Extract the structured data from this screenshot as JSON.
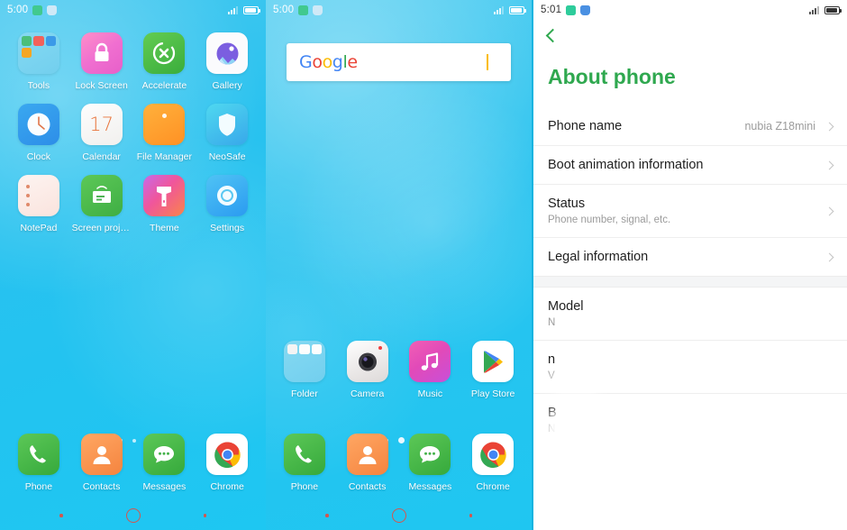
{
  "panel_home": {
    "statusbar": {
      "time": "5:00",
      "icons": [
        "gallery-sync-icon",
        "shield-icon"
      ],
      "signal": "signal-bars-icon",
      "battery": "battery-icon"
    },
    "apps": [
      {
        "label": "Tools",
        "icon": "tools-folder-icon"
      },
      {
        "label": "Lock Screen",
        "icon": "lock-icon"
      },
      {
        "label": "Accelerate",
        "icon": "accelerate-icon"
      },
      {
        "label": "Gallery",
        "icon": "gallery-icon"
      },
      {
        "label": "Clock",
        "icon": "clock-icon"
      },
      {
        "label": "Calendar",
        "icon": "calendar-icon",
        "day": "17"
      },
      {
        "label": "File Manager",
        "icon": "file-manager-icon"
      },
      {
        "label": "NeoSafe",
        "icon": "neosafe-shield-icon"
      },
      {
        "label": "NotePad",
        "icon": "notepad-icon"
      },
      {
        "label": "Screen proje…",
        "icon": "screen-projection-icon"
      },
      {
        "label": "Theme",
        "icon": "theme-icon"
      },
      {
        "label": "Settings",
        "icon": "settings-icon"
      }
    ],
    "dock": [
      {
        "label": "Phone",
        "icon": "phone-icon"
      },
      {
        "label": "Contacts",
        "icon": "contacts-icon"
      },
      {
        "label": "Messages",
        "icon": "messages-icon"
      },
      {
        "label": "Chrome",
        "icon": "chrome-icon"
      }
    ],
    "page_indicator": {
      "pages": 3,
      "active": 3
    }
  },
  "panel_second": {
    "statusbar": {
      "time": "5:00"
    },
    "search": {
      "logo": "Google",
      "letters": [
        "G",
        "o",
        "o",
        "g",
        "l",
        "e"
      ],
      "mic": "microphone-icon"
    },
    "apps": [
      {
        "label": "Folder",
        "icon": "google-folder-icon"
      },
      {
        "label": "Camera",
        "icon": "camera-icon"
      },
      {
        "label": "Music",
        "icon": "music-icon"
      },
      {
        "label": "Play Store",
        "icon": "play-store-icon"
      }
    ],
    "dock": [
      {
        "label": "Phone",
        "icon": "phone-icon"
      },
      {
        "label": "Contacts",
        "icon": "contacts-icon"
      },
      {
        "label": "Messages",
        "icon": "messages-icon"
      },
      {
        "label": "Chrome",
        "icon": "chrome-icon"
      }
    ],
    "page_indicator": {
      "pages": 3,
      "active": 2
    }
  },
  "panel_settings": {
    "statusbar": {
      "time": "5:01",
      "icons": [
        "gallery-sync-icon",
        "shield-icon"
      ]
    },
    "back": "back-chevron-icon",
    "title": "About phone",
    "accent_color": "#2fa84f",
    "rows": [
      {
        "title": "Phone name",
        "subtitle": "",
        "value": "nubia Z18mini",
        "chevron": true
      },
      {
        "title": "Boot animation information",
        "subtitle": "",
        "value": "",
        "chevron": true
      },
      {
        "title": "Status",
        "subtitle": "Phone number, signal, etc.",
        "value": "",
        "chevron": true
      },
      {
        "title": "Legal information",
        "subtitle": "",
        "value": "",
        "chevron": true
      }
    ],
    "rows_redacted": [
      {
        "title": "Model",
        "subtitle": "N",
        "chevron": false
      },
      {
        "title": "n",
        "subtitle": "V",
        "chevron": false
      },
      {
        "title": "B",
        "subtitle": "N",
        "chevron": false
      }
    ]
  }
}
